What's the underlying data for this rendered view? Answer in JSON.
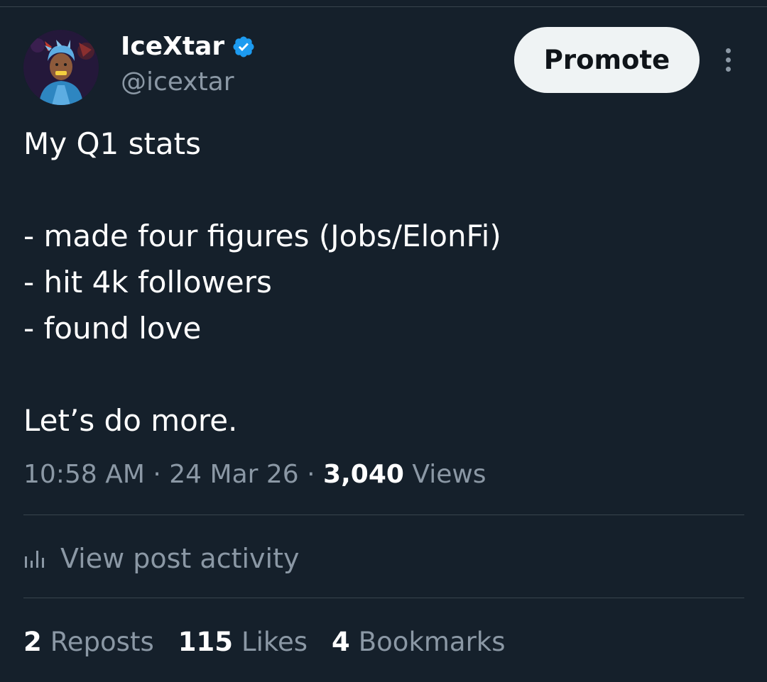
{
  "author": {
    "display_name": "IceXtar",
    "handle": "@icextar",
    "verified_icon": "verified-badge-icon",
    "avatar_icon": "avatar-image"
  },
  "actions": {
    "promote_label": "Promote",
    "more_icon": "more-vertical-icon"
  },
  "post": {
    "lines": [
      "My Q1 stats",
      "",
      "- made four figures (Jobs/ElonFi)",
      "- hit 4k followers",
      "- found love",
      "",
      "Let’s do more."
    ]
  },
  "meta": {
    "time": "10:58 AM",
    "separator": "·",
    "date": "24 Mar 26",
    "views_count": "3,040",
    "views_label": "Views"
  },
  "activity": {
    "icon": "bar-chart-icon",
    "label": "View post activity"
  },
  "stats": {
    "reposts_count": "2",
    "reposts_label": "Reposts",
    "likes_count": "115",
    "likes_label": "Likes",
    "bookmarks_count": "4",
    "bookmarks_label": "Bookmarks"
  },
  "colors": {
    "background": "#15202b",
    "text_primary": "#ffffff",
    "text_secondary": "#8b98a5",
    "divider": "#38444d",
    "verified_blue": "#1d9bf0",
    "promote_bg": "#eff3f4"
  }
}
